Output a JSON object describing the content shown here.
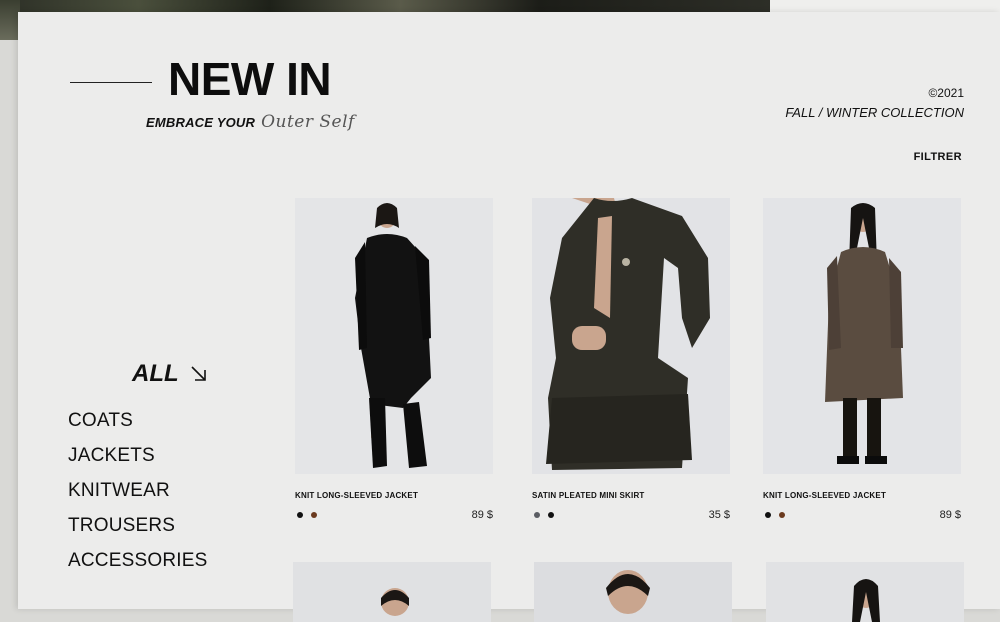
{
  "header": {
    "title": "NEW IN",
    "tagline_prefix": "EMBRACE YOUR",
    "tagline_script": "Outer Self",
    "year": "©2021",
    "collection": "FALL / WINTER COLLECTION",
    "filter_label": "FILTRER"
  },
  "categories": {
    "active": "ALL",
    "active_icon": "arrow-down-right-icon",
    "items": [
      "COATS",
      "JACKETS",
      "KNITWEAR",
      "TROUSERS",
      "ACCESSORIES"
    ]
  },
  "products": [
    {
      "name": "KNIT LONG-SLEEVED JACKET",
      "price": "89 $",
      "swatches": [
        "#111111",
        "#6b3a1e"
      ]
    },
    {
      "name": "SATIN PLEATED MINI SKIRT",
      "price": "35 $",
      "swatches": [
        "#5a5d63",
        "#111111"
      ]
    },
    {
      "name": "KNIT LONG-SLEEVED JACKET",
      "price": "89 $",
      "swatches": [
        "#111111",
        "#6b3a1e"
      ]
    }
  ],
  "colors": {
    "sheet_background": "#ececeb",
    "text": "#111111"
  }
}
